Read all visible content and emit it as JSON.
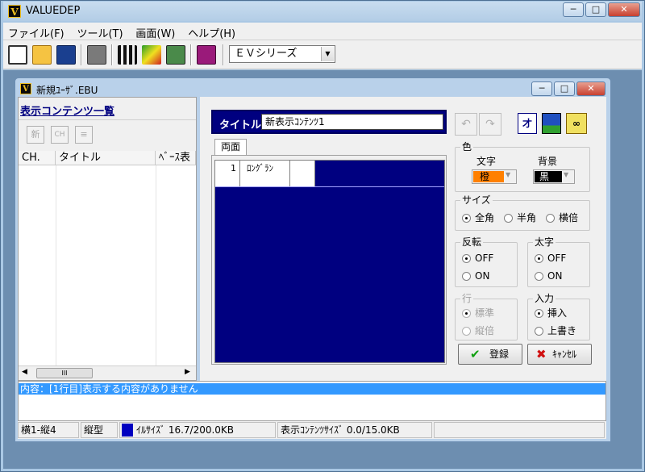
{
  "app": {
    "title": "VALUEDEP",
    "icon_letter": "V"
  },
  "menu": [
    "ファイル(F)",
    "ツール(T)",
    "画面(W)",
    "ヘルプ(H)"
  ],
  "toolbar": {
    "series_combo": "ＥＶシリーズ"
  },
  "child": {
    "title": "新規ﾕｰｻﾞ.EBU"
  },
  "left": {
    "heading": "表示コンテンツ一覧",
    "buttons": [
      "新",
      "CH",
      "≡"
    ],
    "columns": [
      "CH.",
      "タイトル",
      "ﾍﾞｰｽ表"
    ],
    "scroll_label": "III"
  },
  "editor": {
    "title_label": "タイトル",
    "title_value": "新表示ｺﾝﾃﾝﾂ1",
    "tab": "両面",
    "row_number": "1",
    "row_label": "ﾛﾝｸﾞﾗﾝ"
  },
  "options": {
    "color": {
      "label": "色",
      "text_label": "文字",
      "bg_label": "背景",
      "text_value": "橙",
      "bg_value": "黒",
      "text_color": "#ff8000",
      "bg_color": "#000000"
    },
    "size": {
      "label": "サイズ",
      "options": [
        "全角",
        "半角",
        "横倍"
      ]
    },
    "invert": {
      "label": "反転",
      "options": [
        "OFF",
        "ON"
      ]
    },
    "bold": {
      "label": "太字",
      "options": [
        "OFF",
        "ON"
      ]
    },
    "line": {
      "label": "行",
      "options": [
        "標準",
        "縦倍"
      ]
    },
    "input": {
      "label": "入力",
      "options": [
        "挿入",
        "上書き"
      ]
    }
  },
  "buttons": {
    "register": "登録",
    "cancel": "ｷｬﾝｾﾙ"
  },
  "message": "内容：[1行目]表示する内容がありません",
  "status": {
    "position": "横1-縦4",
    "orientation": "縦型",
    "file_size": "ｲﾙｻｲｽﾞ 16.7/200.0KB",
    "content_size": "表示ｺﾝﾃﾝﾂｻｲｽﾞ 0.0/15.0KB"
  },
  "colors": {
    "navy": "#000080",
    "accent": "#3399ff"
  }
}
